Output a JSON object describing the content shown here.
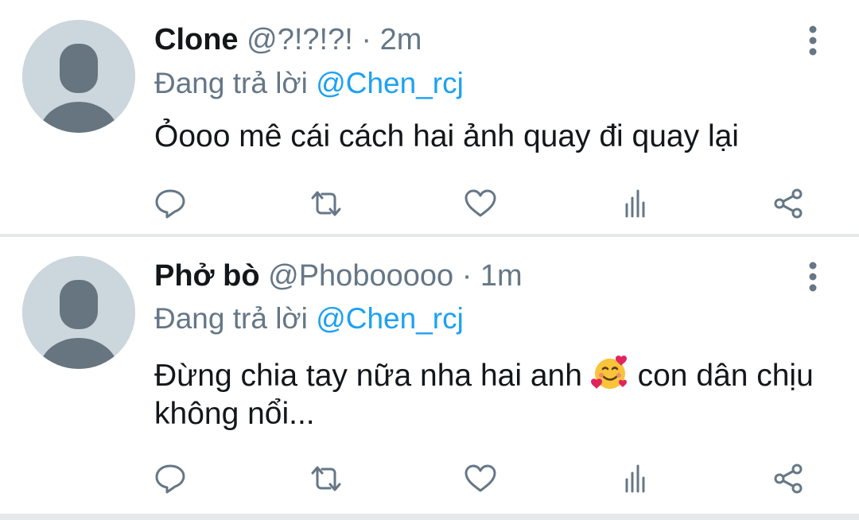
{
  "colors": {
    "text_primary": "#14171a",
    "text_secondary": "#657786",
    "mention": "#1da1f2",
    "avatar_bg": "#ccd6dd",
    "avatar_fg": "#66757f",
    "icon": "#657786",
    "divider": "#e6e9ec"
  },
  "tweets": [
    {
      "display_name": "Clone",
      "handle": "@?!?!?!",
      "separator": "·",
      "time": "2m",
      "reply_prefix": "Đang trả lời",
      "reply_to": "@Chen_rcj",
      "text": "Ỏooo mê cái cách hai ảnh quay đi quay lại",
      "icons": [
        "more-icon",
        "reply-icon",
        "retweet-icon",
        "like-icon",
        "analytics-icon",
        "share-icon"
      ]
    },
    {
      "display_name": "Phở bò",
      "handle": "@Phobooooo",
      "separator": "·",
      "time": "1m",
      "reply_prefix": "Đang trả lời",
      "reply_to": "@Chen_rcj",
      "text_before_emoji": "Đừng chia tay nữa nha hai anh",
      "emoji": "smiling-face-with-hearts-emoji",
      "text_after_emoji": "con dân chịu không nổi...",
      "icons": [
        "more-icon",
        "reply-icon",
        "retweet-icon",
        "like-icon",
        "analytics-icon",
        "share-icon"
      ]
    }
  ]
}
